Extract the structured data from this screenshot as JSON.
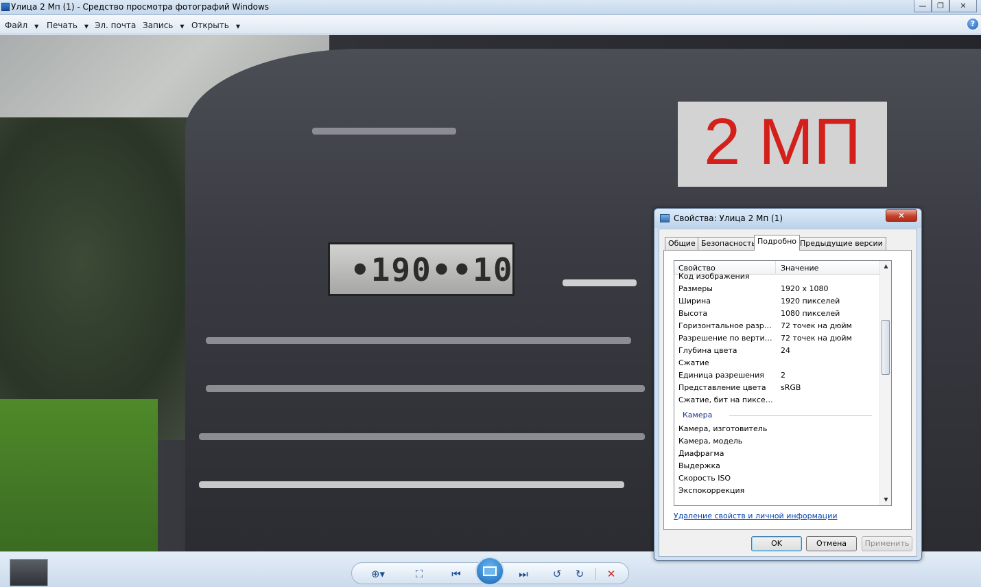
{
  "window": {
    "title": "Улица 2 Мп (1) - Средство просмотра фотографий Windows"
  },
  "menu": {
    "file": "Файл",
    "print": "Печать",
    "email": "Эл. почта",
    "burn": "Запись",
    "open": "Открыть"
  },
  "photo": {
    "overlay_text": "2 МП",
    "plate_text": "•190••10"
  },
  "dialog": {
    "title": "Свойства: Улица 2 Мп (1)",
    "tabs": [
      "Общие",
      "Безопасность",
      "Подробно",
      "Предыдущие версии"
    ],
    "active_tab": "Подробно",
    "columns": {
      "property": "Свойство",
      "value": "Значение"
    },
    "rows_image": [
      {
        "prop": "Код изображения",
        "val": ""
      },
      {
        "prop": "Размеры",
        "val": "1920 x 1080"
      },
      {
        "prop": "Ширина",
        "val": "1920 пикселей"
      },
      {
        "prop": "Высота",
        "val": "1080 пикселей"
      },
      {
        "prop": "Горизонтальное разреше...",
        "val": "72 точек на дюйм"
      },
      {
        "prop": "Разрешение по вертикали",
        "val": "72 точек на дюйм"
      },
      {
        "prop": "Глубина цвета",
        "val": "24"
      },
      {
        "prop": "Сжатие",
        "val": ""
      },
      {
        "prop": "Единица разрешения",
        "val": "2"
      },
      {
        "prop": "Представление цвета",
        "val": "sRGB"
      },
      {
        "prop": "Сжатие, бит на пиксель",
        "val": ""
      }
    ],
    "section_camera": "Камера",
    "rows_camera": [
      {
        "prop": "Камера, изготовитель",
        "val": ""
      },
      {
        "prop": "Камера, модель",
        "val": ""
      },
      {
        "prop": "Диафрагма",
        "val": ""
      },
      {
        "prop": "Выдержка",
        "val": ""
      },
      {
        "prop": "Скорость ISO",
        "val": ""
      },
      {
        "prop": "Экспокоррекция",
        "val": ""
      }
    ],
    "remove_link": "Удаление свойств и личной информации",
    "buttons": {
      "ok": "OK",
      "cancel": "Отмена",
      "apply": "Применить"
    }
  },
  "colors": {
    "overlay_red": "#d3201b",
    "link": "#0645ad",
    "section_title": "#1e3287"
  },
  "icons": [
    "app-icon",
    "help-icon",
    "zoom-icon",
    "fit-icon",
    "previous-icon",
    "slideshow-icon",
    "next-icon",
    "rotate-left-icon",
    "rotate-right-icon",
    "delete-icon"
  ]
}
